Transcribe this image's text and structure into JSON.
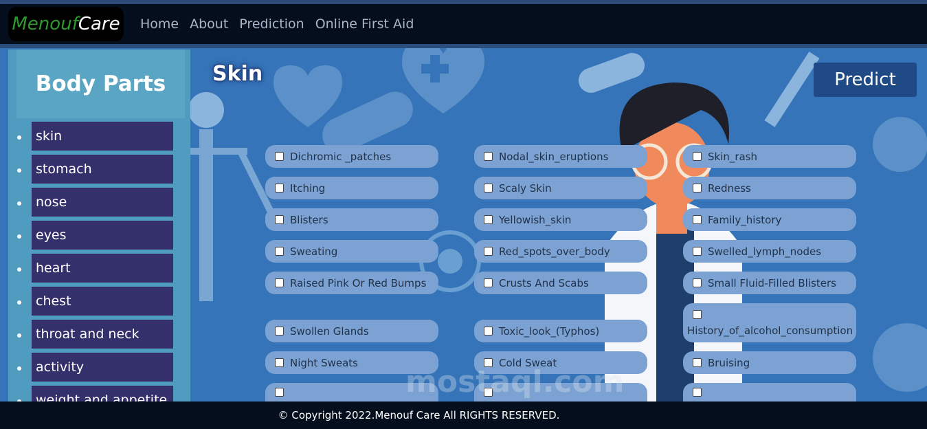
{
  "brand": {
    "part1": "Menouf",
    "part2": "Care"
  },
  "nav": {
    "items": [
      "Home",
      "About",
      "Prediction",
      "Online First Aid"
    ]
  },
  "sidebar": {
    "title": "Body Parts",
    "items": [
      "skin",
      "stomach",
      "nose",
      "eyes",
      "heart",
      "chest",
      "throat and neck",
      "activity",
      "weight and appetite"
    ]
  },
  "section": {
    "title": "Skin"
  },
  "predict_label": "Predict",
  "symptoms": {
    "col1": [
      "Dichromic _patches",
      "Itching",
      "Blisters",
      "Sweating",
      "Raised Pink Or Red Bumps",
      "Swollen Glands",
      "Night Sweats",
      ""
    ],
    "col2": [
      "Nodal_skin_eruptions",
      "Scaly Skin",
      "Yellowish_skin",
      "Red_spots_over_body",
      "Crusts And Scabs",
      "Toxic_look_(Typhos)",
      "Cold Sweat",
      ""
    ],
    "col3": [
      "Skin_rash",
      "Redness",
      "Family_history",
      "Swelled_lymph_nodes",
      "Small Fluid-Filled Blisters",
      "History_of_alcohol_consumption",
      "Bruising",
      ""
    ]
  },
  "footer": {
    "text": "© Copyright 2022.Menouf Care All RIGHTS RESERVED."
  },
  "watermark": {
    "text": "mostaql.com"
  },
  "colors": {
    "navbar": "#050e1c",
    "background": "#3574b8",
    "sidebar": "#4f9cc0",
    "sidebar_item": "#34306b",
    "symptom_pill": "#7ba2d2",
    "predict_button": "#1f4a85",
    "brand_green": "#2e9a2e"
  }
}
